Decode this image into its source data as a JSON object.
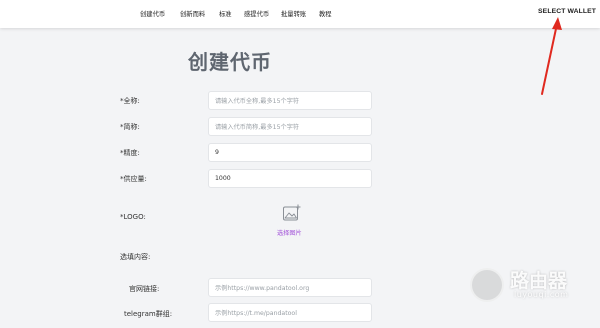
{
  "nav": {
    "items": [
      {
        "label": "创建代币"
      },
      {
        "label": "创新而料"
      },
      {
        "label": "标准"
      },
      {
        "label": "感提代币"
      },
      {
        "label": "批量转账"
      },
      {
        "label": "教程"
      }
    ],
    "wallet_button": "SELECT WALLET"
  },
  "form": {
    "title": "创建代币",
    "fields": [
      {
        "label": "*全称:",
        "value": "",
        "placeholder": "请输入代币全称,最多15个字符"
      },
      {
        "label": "*简称:",
        "value": "",
        "placeholder": "请输入代币简称,最多15个字符"
      },
      {
        "label": "*精度:",
        "value": "9",
        "placeholder": ""
      },
      {
        "label": "*供应量:",
        "value": "1000",
        "placeholder": ""
      }
    ],
    "logo_label": "*LOGO:",
    "logo_upload_text": "选择图片",
    "optional_section_label": "选填内容:",
    "optional_fields": [
      {
        "label": "官网链接:",
        "value": "",
        "placeholder": "示例https://www.pandatool.org"
      },
      {
        "label": "telegram群组:",
        "value": "",
        "placeholder": "示例https://t.me/pandatool"
      }
    ]
  },
  "annotation": {
    "arrow_color": "#e0291f"
  },
  "watermark": {
    "title": "路由器",
    "subtitle": "luyouqi.com"
  }
}
